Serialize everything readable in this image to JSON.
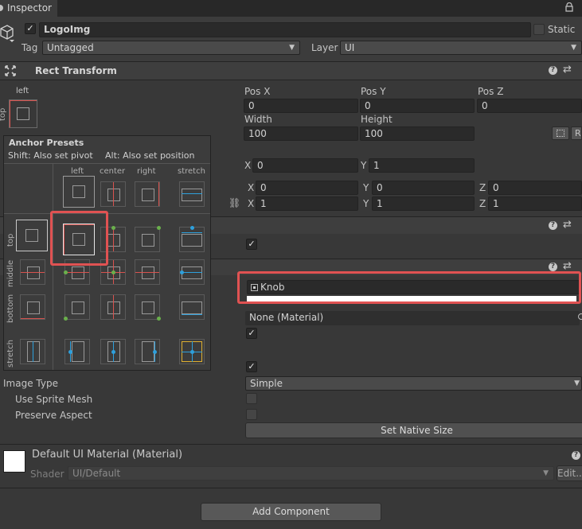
{
  "window": {
    "tab_title": "Inspector",
    "lock_icon": "lock-icon"
  },
  "object": {
    "name": "LogoImg",
    "static_label": "Static",
    "tag_label": "Tag",
    "tag_value": "Untagged",
    "layer_label": "Layer",
    "layer_value": "UI"
  },
  "rect_transform": {
    "title": "Rect Transform",
    "anchor_h": "left",
    "anchor_v": "top",
    "pos_x_label": "Pos X",
    "pos_x": "0",
    "pos_y_label": "Pos Y",
    "pos_y": "0",
    "pos_z_label": "Pos Z",
    "pos_z": "0",
    "width_label": "Width",
    "width": "100",
    "height_label": "Height",
    "height": "100",
    "pivot_x_label": "X",
    "pivot_x": "0",
    "pivot_y_label": "Y",
    "pivot_y": "1",
    "rot_x_label": "X",
    "rot_x": "0",
    "rot_y_label": "Y",
    "rot_y": "0",
    "rot_z_label": "Z",
    "rot_z": "0",
    "scale_x_label": "X",
    "scale_x": "1",
    "scale_y_label": "Y",
    "scale_y": "1",
    "scale_z_label": "Z",
    "scale_z": "1",
    "r_button": "R"
  },
  "anchor_presets": {
    "title": "Anchor Presets",
    "hint_shift": "Shift: Also set pivot",
    "hint_alt": "Alt: Also set position",
    "columns": [
      "left",
      "center",
      "right",
      "stretch"
    ],
    "rows": [
      "top",
      "middle",
      "bottom",
      "stretch"
    ],
    "selected": {
      "row": "top",
      "column": "left"
    }
  },
  "image": {
    "source_image": "Knob",
    "material": "None (Material)",
    "raycast_checked": true,
    "maskable_checked": true,
    "image_type_label": "Image Type",
    "image_type_value": "Simple",
    "use_sprite_mesh_label": "Use Sprite Mesh",
    "preserve_aspect_label": "Preserve Aspect",
    "set_native_size": "Set Native Size"
  },
  "material": {
    "title": "Default UI Material (Material)",
    "shader_label": "Shader",
    "shader_value": "UI/Default",
    "edit_button": "Edit..."
  },
  "add_component": "Add Component",
  "colors": {
    "highlight_red": "#e05252",
    "anchor_red": "#d9534f",
    "anchor_blue": "#2ea0dc",
    "anchor_green": "#6ab04c",
    "anchor_yellow": "#e0b030"
  }
}
